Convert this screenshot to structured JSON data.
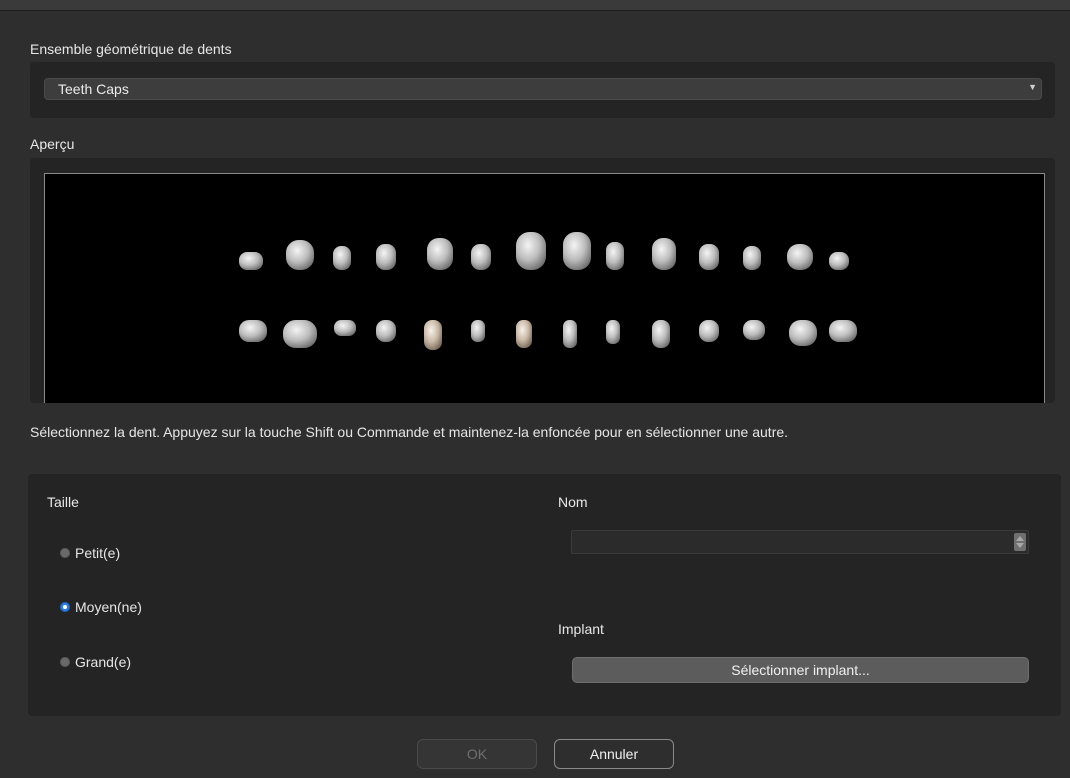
{
  "geometry_set": {
    "label": "Ensemble géométrique de dents",
    "selected": "Teeth Caps"
  },
  "preview": {
    "label": "Aperçu",
    "upper_teeth_count": 14,
    "lower_teeth_count": 14
  },
  "hint": "Sélectionnez la dent. Appuyez sur la touche Shift ou Commande et maintenez-la enfoncée pour en sélectionner une autre.",
  "size": {
    "label": "Taille",
    "options": [
      "Petit(e)",
      "Moyen(ne)",
      "Grand(e)"
    ],
    "selected": "Moyen(ne)"
  },
  "name": {
    "label": "Nom",
    "value": ""
  },
  "implant": {
    "label": "Implant",
    "button_label": "Sélectionner implant..."
  },
  "buttons": {
    "ok": "OK",
    "cancel": "Annuler"
  },
  "colors": {
    "background": "#2e2e2e",
    "panel": "#242424",
    "accent_radio": "#2f7fe0",
    "preview_bg": "#000000"
  }
}
